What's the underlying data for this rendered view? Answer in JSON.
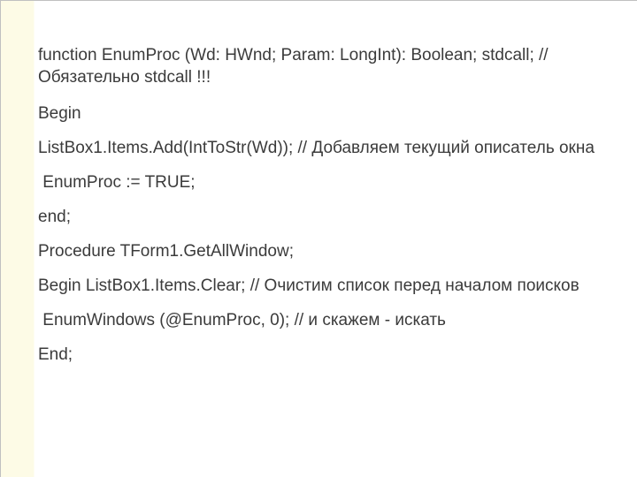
{
  "code": {
    "l1": "function EnumProc (Wd: HWnd; Param: LongInt): Boolean; stdcall; // Обязательно stdcall !!!",
    "l2": "Begin",
    "l3": "ListBox1.Items.Add(IntToStr(Wd)); // Добавляем текущий описатель окна",
    "l4": " EnumProc := TRUE;",
    "l5": "end;",
    "l6": "Procedure TForm1.GetAllWindow;",
    "l7": "Begin ListBox1.Items.Clear; // Очистим список перед началом поисков",
    "l8": " EnumWindows (@EnumProc, 0); // и скажем - искать",
    "l9": "End;"
  }
}
